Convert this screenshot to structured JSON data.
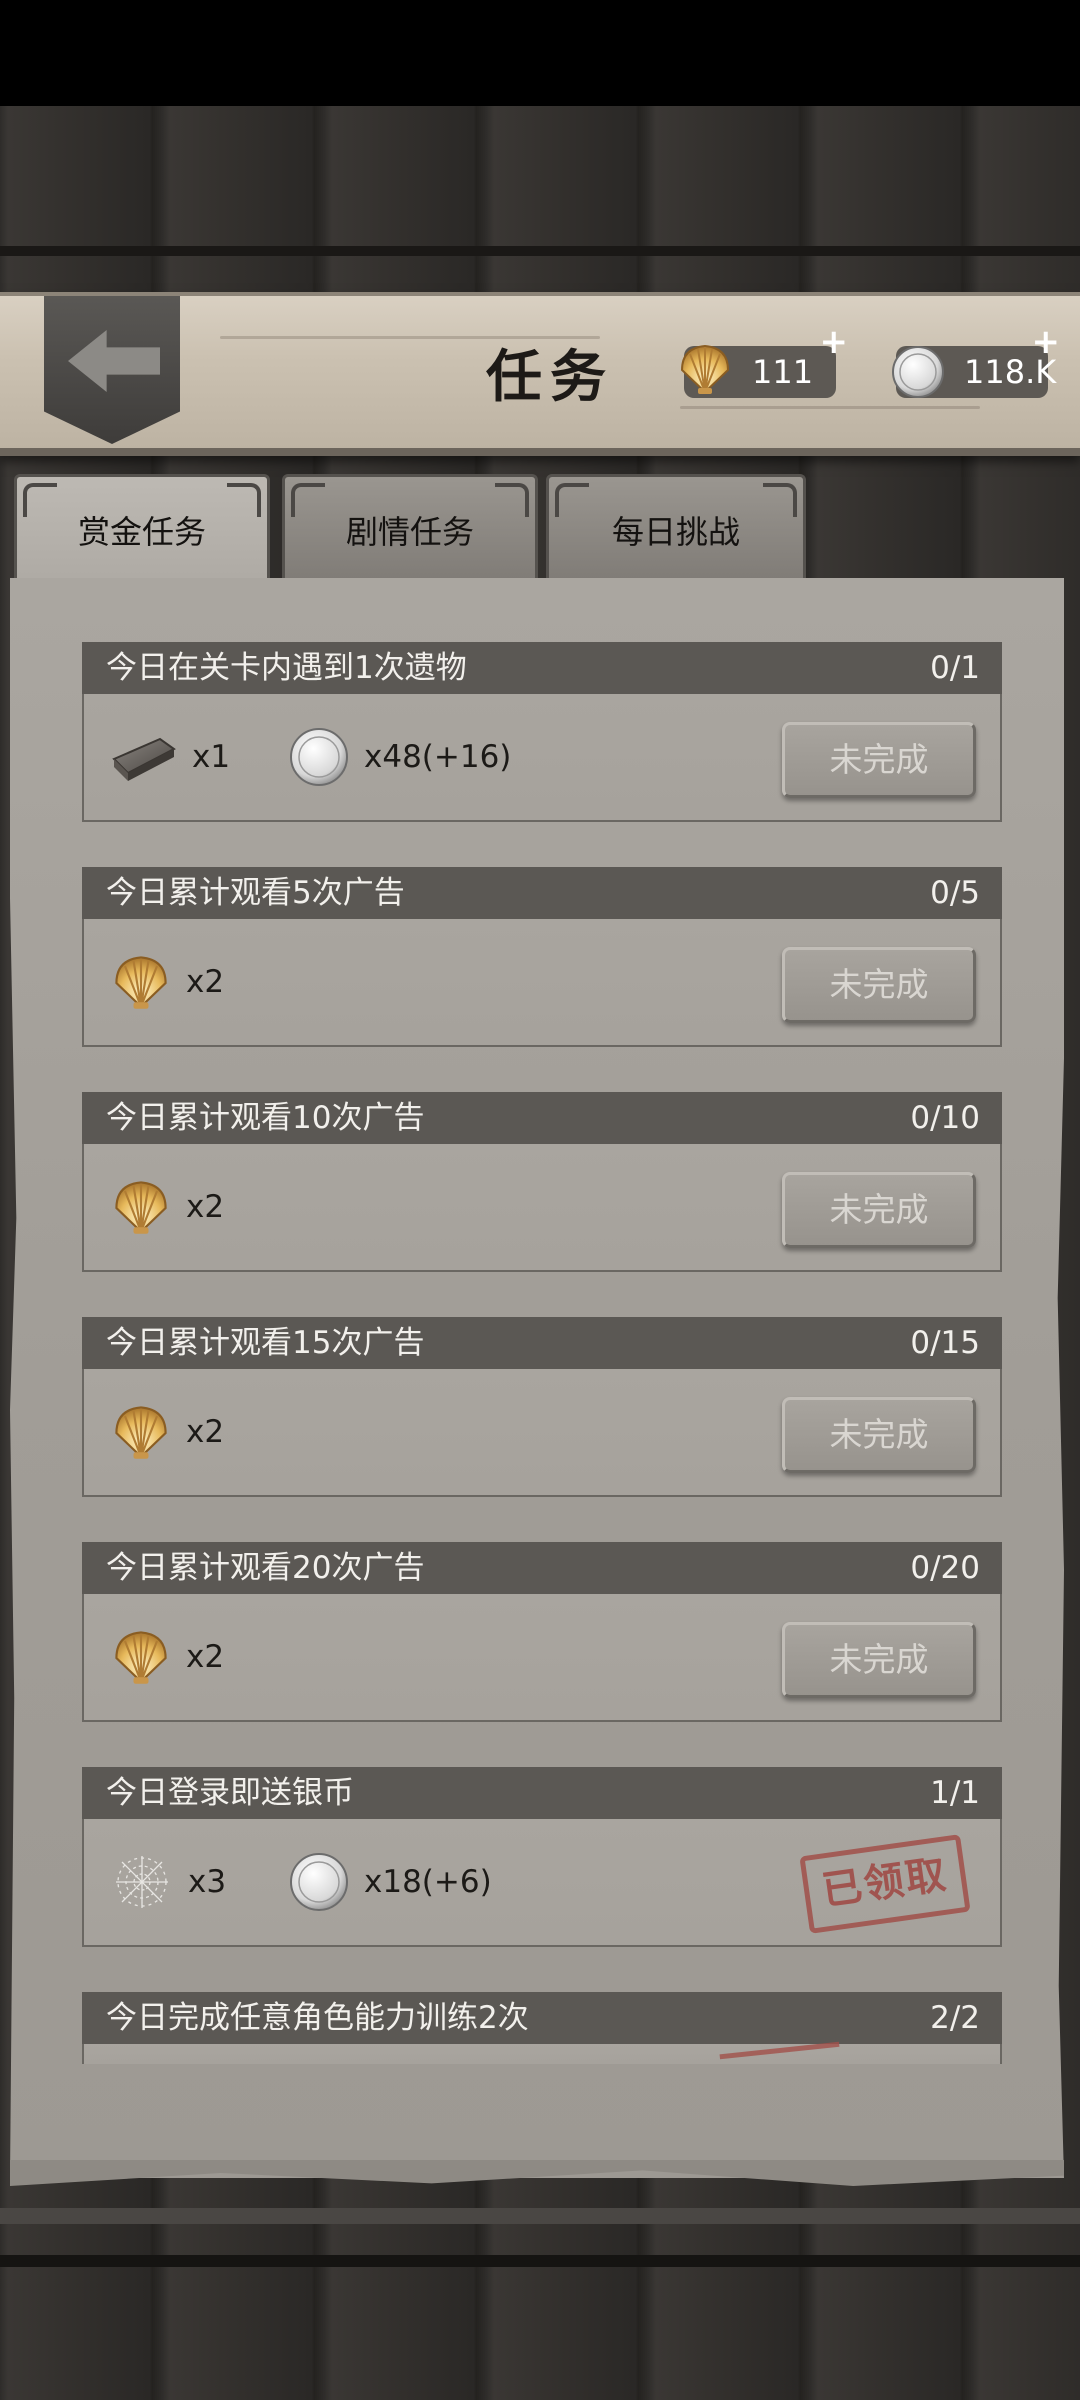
{
  "header": {
    "title": "任务",
    "shells": "111",
    "coins": "118.K",
    "plus": "+"
  },
  "tabs": [
    {
      "label": "赏金任务",
      "active": true
    },
    {
      "label": "剧情任务",
      "active": false
    },
    {
      "label": "每日挑战",
      "active": false
    }
  ],
  "tasks": [
    {
      "name": "今日在关卡内遇到1次遗物",
      "progress": "0/1",
      "rewards": [
        {
          "icon": "wood-plank-icon",
          "qty": "x1"
        },
        {
          "icon": "silver-coin-icon",
          "qty": "x48(+16)"
        }
      ],
      "status": "未完成"
    },
    {
      "name": "今日累计观看5次广告",
      "progress": "0/5",
      "rewards": [
        {
          "icon": "shell-icon",
          "qty": "x2"
        }
      ],
      "status": "未完成"
    },
    {
      "name": "今日累计观看10次广告",
      "progress": "0/10",
      "rewards": [
        {
          "icon": "shell-icon",
          "qty": "x2"
        }
      ],
      "status": "未完成"
    },
    {
      "name": "今日累计观看15次广告",
      "progress": "0/15",
      "rewards": [
        {
          "icon": "shell-icon",
          "qty": "x2"
        }
      ],
      "status": "未完成"
    },
    {
      "name": "今日累计观看20次广告",
      "progress": "0/20",
      "rewards": [
        {
          "icon": "shell-icon",
          "qty": "x2"
        }
      ],
      "status": "未完成"
    },
    {
      "name": "今日登录即送银币",
      "progress": "1/1",
      "rewards": [
        {
          "icon": "cobweb-icon",
          "qty": "x3"
        },
        {
          "icon": "silver-coin-icon",
          "qty": "x18(+6)"
        }
      ],
      "status": "已领取"
    },
    {
      "name": "今日完成任意角色能力训练2次",
      "progress": "2/2"
    }
  ]
}
